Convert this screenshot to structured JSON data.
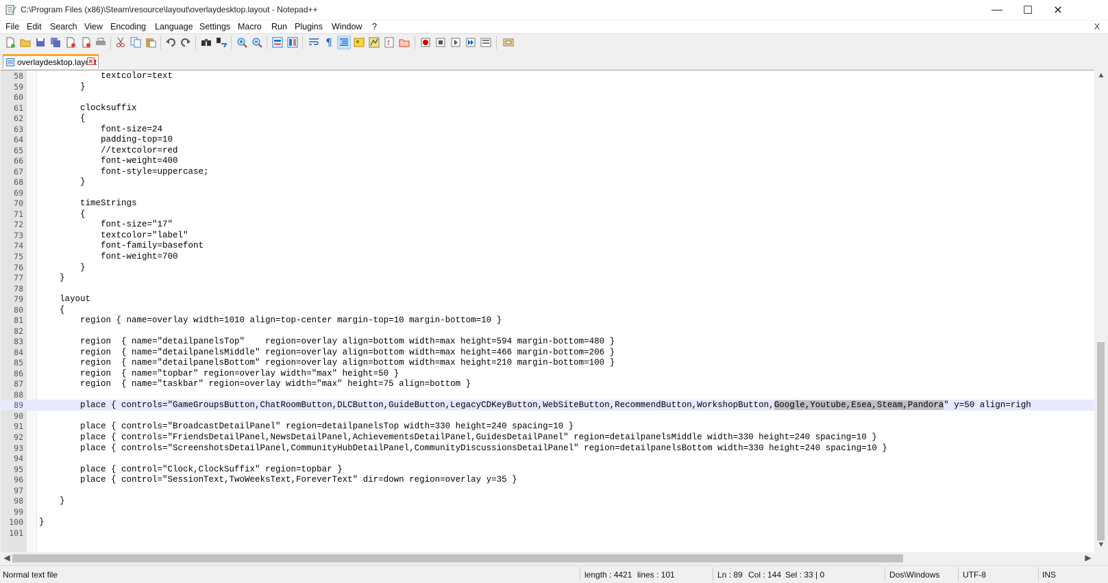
{
  "window": {
    "title": "C:\\Program Files (x86)\\Steam\\resource\\layout\\overlaydesktop.layout - Notepad++",
    "min_glyph": "—",
    "max_glyph": "☐",
    "close_glyph": "✕"
  },
  "menu": {
    "items": [
      "File",
      "Edit",
      "Search",
      "View",
      "Encoding",
      "Language",
      "Settings",
      "Macro",
      "Run",
      "Plugins",
      "Window",
      "?"
    ],
    "close_label": "X"
  },
  "toolbar": {
    "icons": [
      "new-file-icon",
      "open-file-icon",
      "save-icon",
      "save-all-icon",
      "close-icon",
      "close-all-icon",
      "print-icon",
      "cut-icon",
      "copy-icon",
      "paste-icon",
      "undo-icon",
      "redo-icon",
      "find-icon",
      "replace-icon",
      "zoom-in-icon",
      "zoom-out-icon",
      "sync-vertical-icon",
      "sync-horizontal-icon",
      "word-wrap-icon",
      "show-all-characters-icon",
      "indent-guide-icon",
      "user-defined-language-icon",
      "document-map-icon",
      "function-list-icon",
      "folder-as-workspace-icon",
      "record-macro-icon",
      "stop-record-icon",
      "play-macro-icon",
      "play-multiple-icon",
      "save-macro-icon",
      "monitoring-icon"
    ]
  },
  "tab": {
    "label": "overlaydesktop.layout"
  },
  "editor": {
    "current_line": "89",
    "lines": [
      {
        "n": "58",
        "t": "            textcolor=text"
      },
      {
        "n": "59",
        "t": "        }"
      },
      {
        "n": "60",
        "t": ""
      },
      {
        "n": "61",
        "t": "        clocksuffix"
      },
      {
        "n": "62",
        "t": "        {"
      },
      {
        "n": "63",
        "t": "            font-size=24"
      },
      {
        "n": "64",
        "t": "            padding-top=10"
      },
      {
        "n": "65",
        "t": "            //textcolor=red"
      },
      {
        "n": "66",
        "t": "            font-weight=400"
      },
      {
        "n": "67",
        "t": "            font-style=uppercase;"
      },
      {
        "n": "68",
        "t": "        }"
      },
      {
        "n": "69",
        "t": ""
      },
      {
        "n": "70",
        "t": "        timeStrings"
      },
      {
        "n": "71",
        "t": "        {"
      },
      {
        "n": "72",
        "t": "            font-size=\"17\""
      },
      {
        "n": "73",
        "t": "            textcolor=\"label\""
      },
      {
        "n": "74",
        "t": "            font-family=basefont"
      },
      {
        "n": "75",
        "t": "            font-weight=700"
      },
      {
        "n": "76",
        "t": "        }"
      },
      {
        "n": "77",
        "t": "    }"
      },
      {
        "n": "78",
        "t": ""
      },
      {
        "n": "79",
        "t": "    layout"
      },
      {
        "n": "80",
        "t": "    {"
      },
      {
        "n": "81",
        "t": "        region { name=overlay width=1010 align=top-center margin-top=10 margin-bottom=10 }"
      },
      {
        "n": "82",
        "t": ""
      },
      {
        "n": "83",
        "t": "        region  { name=\"detailpanelsTop\"    region=overlay align=bottom width=max height=594 margin-bottom=480 }"
      },
      {
        "n": "84",
        "t": "        region  { name=\"detailpanelsMiddle\" region=overlay align=bottom width=max height=466 margin-bottom=206 }"
      },
      {
        "n": "85",
        "t": "        region  { name=\"detailpanelsBottom\" region=overlay align=bottom width=max height=210 margin-bottom=100 }"
      },
      {
        "n": "86",
        "t": "        region  { name=\"topbar\" region=overlay width=\"max\" height=50 }"
      },
      {
        "n": "87",
        "t": "        region  { name=\"taskbar\" region=overlay width=\"max\" height=75 align=bottom }"
      },
      {
        "n": "88",
        "t": ""
      },
      {
        "n": "89",
        "pre": "        place { controls=\"GameGroupsButton,ChatRoomButton,DLCButton,GuideButton,LegacyCDKeyButton,WebSiteButton,RecommendButton,WorkshopButton,",
        "sel": "Google,Youtube,Esea,Steam,Pandora",
        "post": "\" y=50 align=righ"
      },
      {
        "n": "90",
        "t": ""
      },
      {
        "n": "91",
        "t": "        place { controls=\"BroadcastDetailPanel\" region=detailpanelsTop width=330 height=240 spacing=10 }"
      },
      {
        "n": "92",
        "t": "        place { controls=\"FriendsDetailPanel,NewsDetailPanel,AchievementsDetailPanel,GuidesDetailPanel\" region=detailpanelsMiddle width=330 height=240 spacing=10 }"
      },
      {
        "n": "93",
        "t": "        place { controls=\"ScreenshotsDetailPanel,CommunityHubDetailPanel,CommunityDiscussionsDetailPanel\" region=detailpanelsBottom width=330 height=240 spacing=10 }"
      },
      {
        "n": "94",
        "t": ""
      },
      {
        "n": "95",
        "t": "        place { control=\"Clock,ClockSuffix\" region=topbar }"
      },
      {
        "n": "96",
        "t": "        place { control=\"SessionText,TwoWeeksText,ForeverText\" dir=down region=overlay y=35 }"
      },
      {
        "n": "97",
        "t": ""
      },
      {
        "n": "98",
        "t": "    }"
      },
      {
        "n": "99",
        "t": ""
      },
      {
        "n": "100",
        "t": "}"
      },
      {
        "n": "101",
        "t": ""
      }
    ]
  },
  "status": {
    "file_type": "Normal text file",
    "length": "length : 4421",
    "lines": "lines : 101",
    "ln": "Ln : 89",
    "col": "Col : 144",
    "sel": "Sel : 33 | 0",
    "eol": "Dos\\Windows",
    "encoding": "UTF-8",
    "mode": "INS"
  },
  "colors": {
    "tab_accent": "#f9a825",
    "current_line": "#e8e8ff",
    "selection": "#c0c0c0"
  }
}
